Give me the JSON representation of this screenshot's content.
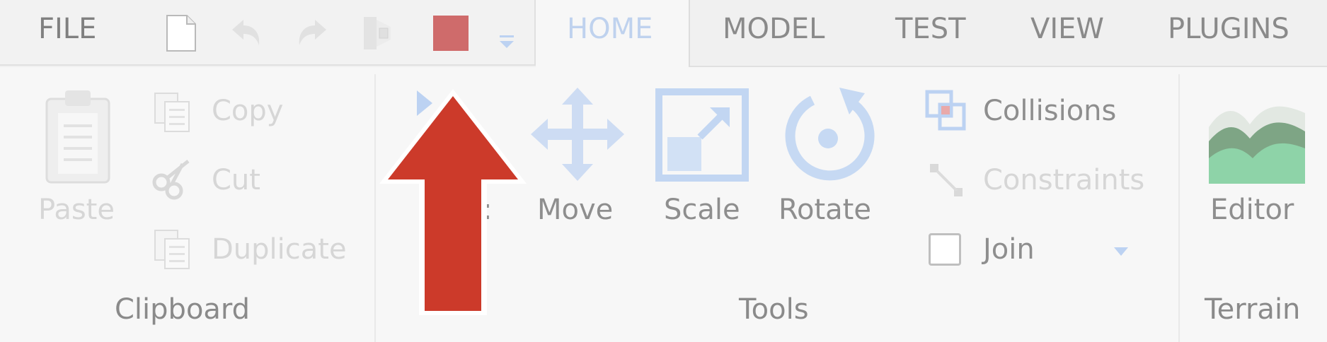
{
  "menu": {
    "file": "FILE",
    "qat_icons": [
      "new-file-icon",
      "undo-icon",
      "redo-icon",
      "import-export-icon",
      "stop-icon",
      "customize-chevron-icon"
    ],
    "tabs": [
      {
        "label": "HOME",
        "active": true
      },
      {
        "label": "MODEL",
        "active": false
      },
      {
        "label": "TEST",
        "active": false
      },
      {
        "label": "VIEW",
        "active": false
      },
      {
        "label": "PLUGINS",
        "active": false
      }
    ]
  },
  "clipboard": {
    "paste": "Paste",
    "copy": "Copy",
    "cut": "Cut",
    "duplicate": "Duplicate",
    "group_label": "Clipboard"
  },
  "tools": {
    "select_partial": ":",
    "move": "Move",
    "scale": "Scale",
    "rotate": "Rotate",
    "collisions": "Collisions",
    "constraints": "Constraints",
    "join": "Join",
    "group_label": "Tools"
  },
  "terrain": {
    "editor": "Editor",
    "group_label": "Terrain"
  },
  "colors": {
    "stop_red": "#cf6b6b",
    "tool_blue": "#bcd2f2",
    "arrow_red": "#cc3a2a",
    "terrain_green": "#8ed3a8"
  }
}
